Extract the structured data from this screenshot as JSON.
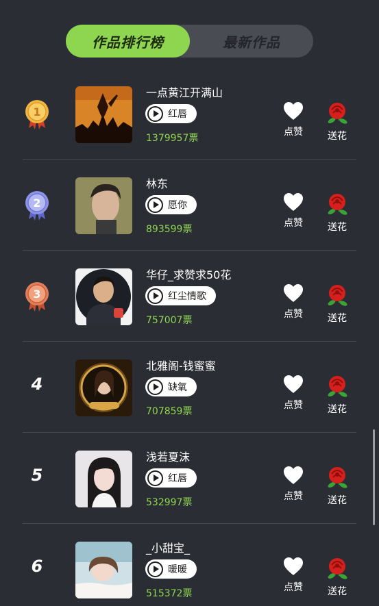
{
  "tabs": [
    {
      "label": "作品排行榜",
      "active": true
    },
    {
      "label": "最新作品",
      "active": false
    }
  ],
  "colors": {
    "accent": "#8fd650",
    "background": "#2b2d35",
    "gold": "#e8a13a",
    "silver": "#8d94e6",
    "bronze": "#e07f5a",
    "rose": "#d6201d"
  },
  "actions": {
    "like_label": "点赞",
    "flower_label": "送花",
    "like_icon": "heart-icon",
    "flower_icon": "rose-icon"
  },
  "entries": [
    {
      "rank": "1",
      "medal": "gold-medal",
      "title": "一点黄江开满山",
      "song": "红唇",
      "votes": "1379957票"
    },
    {
      "rank": "2",
      "medal": "silver-medal",
      "title": "林东",
      "song": "愿你",
      "votes": "893599票"
    },
    {
      "rank": "3",
      "medal": "bronze-medal",
      "title": "华仔_求赞求50花",
      "song": "红尘情歌",
      "votes": "757007票"
    },
    {
      "rank": "4",
      "medal": "",
      "title": "北雅阁-钱蜜蜜",
      "song": "缺氧",
      "votes": "707859票"
    },
    {
      "rank": "5",
      "medal": "",
      "title": "浅若夏沫",
      "song": "红唇",
      "votes": "532997票"
    },
    {
      "rank": "6",
      "medal": "",
      "title": "_小甜宝_",
      "song": "暖暖",
      "votes": "515372票"
    }
  ]
}
